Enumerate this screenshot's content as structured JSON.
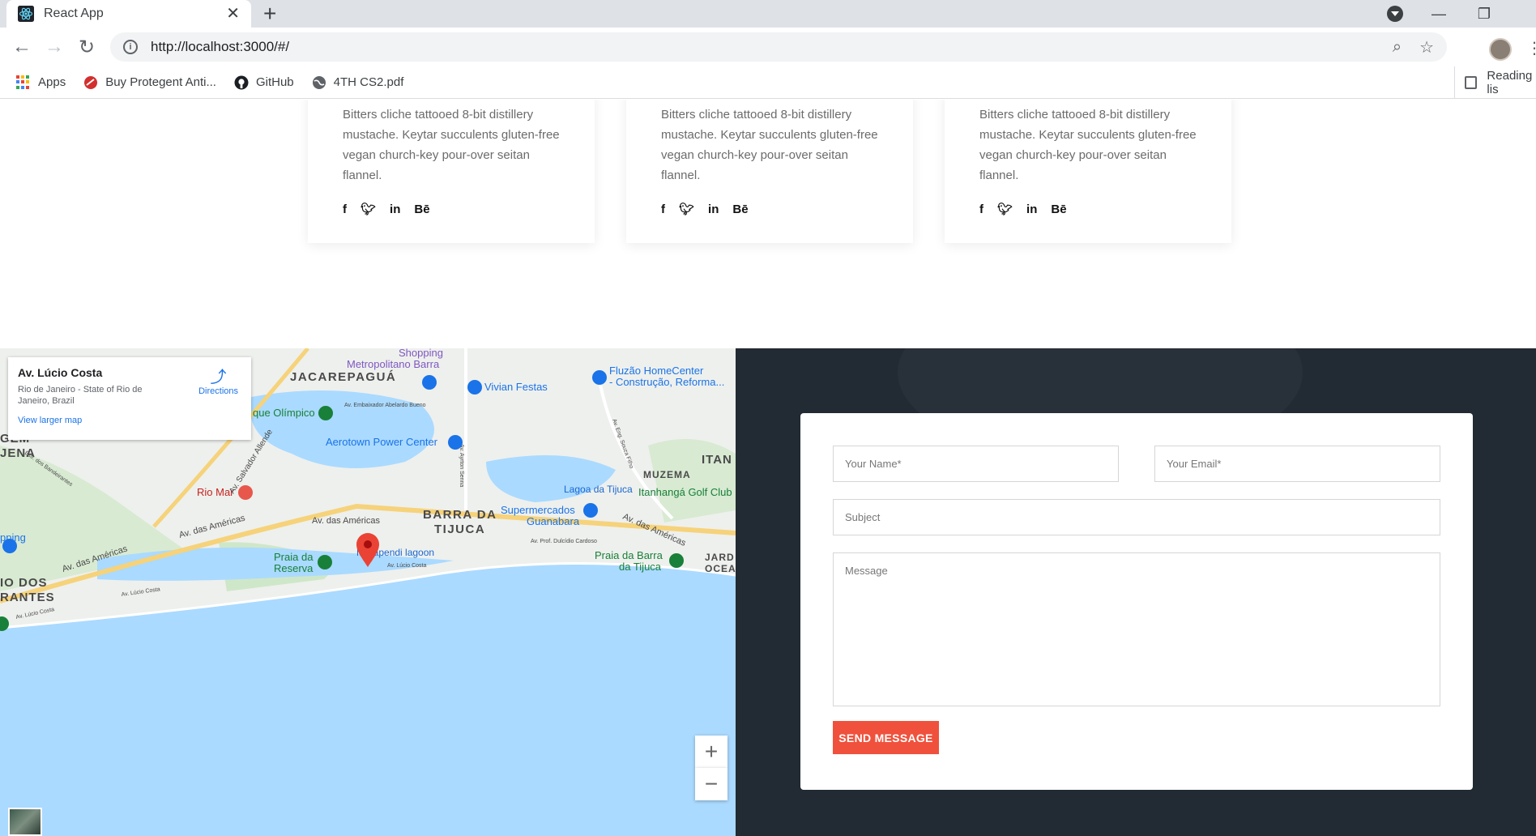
{
  "browser": {
    "tab_title": "React App",
    "url": "http://localhost:3000/#/",
    "bookmarks": [
      {
        "label": "Apps"
      },
      {
        "label": "Buy Protegent Anti..."
      },
      {
        "label": "GitHub"
      },
      {
        "label": "4TH CS2.pdf"
      }
    ],
    "reading_list": "Reading lis"
  },
  "team_cards": [
    {
      "bio": "Bitters cliche tattooed 8-bit distillery mustache. Keytar succulents gluten-free vegan church-key pour-over seitan flannel.",
      "socials": [
        "f",
        "t",
        "in",
        "Bē"
      ]
    },
    {
      "bio": "Bitters cliche tattooed 8-bit distillery mustache. Keytar succulents gluten-free vegan church-key pour-over seitan flannel.",
      "socials": [
        "f",
        "t",
        "in",
        "Bē"
      ]
    },
    {
      "bio": "Bitters cliche tattooed 8-bit distillery mustache. Keytar succulents gluten-free vegan church-key pour-over seitan flannel.",
      "socials": [
        "f",
        "t",
        "in",
        "Bē"
      ]
    }
  ],
  "map": {
    "place_title": "Av. Lúcio Costa",
    "place_address": "Rio de Janeiro - State of Rio de Janeiro, Brazil",
    "directions_label": "Directions",
    "view_larger": "View larger map",
    "zoom_in": "+",
    "zoom_out": "−",
    "labels": {
      "jacarepagua": "JACAREPAGUÁ",
      "metropolitano": "Metropolitano Barra",
      "shopping_top": "Shopping",
      "vivian": "Vivian Festas",
      "fluzao1": "Fluzão HomeCenter",
      "fluzao2": "- Construção, Reforma...",
      "olimpico": "que Olímpico",
      "aerotown": "Aerotown Power Center",
      "gem": "GEM",
      "jena": "JENA",
      "itan": "ITAN",
      "muzema": "MUZEMA",
      "lagoa_tijuca": "Lagoa da Tijuca",
      "itanhanga": "Itanhangá Golf Club",
      "riomar": "Rio Mar",
      "barra1": "BARRA DA",
      "barra2": "TIJUCA",
      "super1": "Supermercados",
      "super2": "Guanabara",
      "av_americas": "Av. das Américas",
      "av_americas2": "Av. das Américas",
      "av_americas3": "Av. das Américas",
      "av_americas4": "Av. das Américas",
      "av_salvador": "Av. Salvador Allende",
      "av_embaixador": "Av. Embaixador Abelardo Bueno",
      "av_ayrton": "Av. Ayrton Senna",
      "av_prof": "Av. Prof. Dulcídio Cardoso",
      "av_eng": "Av. Eng. Souza Filho",
      "est_bandeirantes": "Estr. dos Bandeirantes",
      "ping": "pping",
      "marapendi": "Marapendi lagoon",
      "praia_reserva1": "Praia da",
      "praia_reserva2": "Reserva",
      "praia_barra1": "Praia da Barra",
      "praia_barra2": "da Tijuca",
      "av_lucio": "Av. Lúcio Costa",
      "av_lucio2": "Av. Lúcio Costa",
      "av_lucio3": "Av. Lúcio Costa",
      "rios1": "IO DOS",
      "rios2": "RANTES",
      "jard": "JARD",
      "ocean": "OCEAN"
    }
  },
  "contact_form": {
    "name_placeholder": "Your Name*",
    "email_placeholder": "Your Email*",
    "subject_placeholder": "Subject",
    "message_placeholder": "Message",
    "submit_label": "SEND MESSAGE"
  },
  "colors": {
    "accent": "#f0513c",
    "contact_bg": "#222a33",
    "map_water": "#aadaff",
    "map_land": "#e8f3e1"
  }
}
